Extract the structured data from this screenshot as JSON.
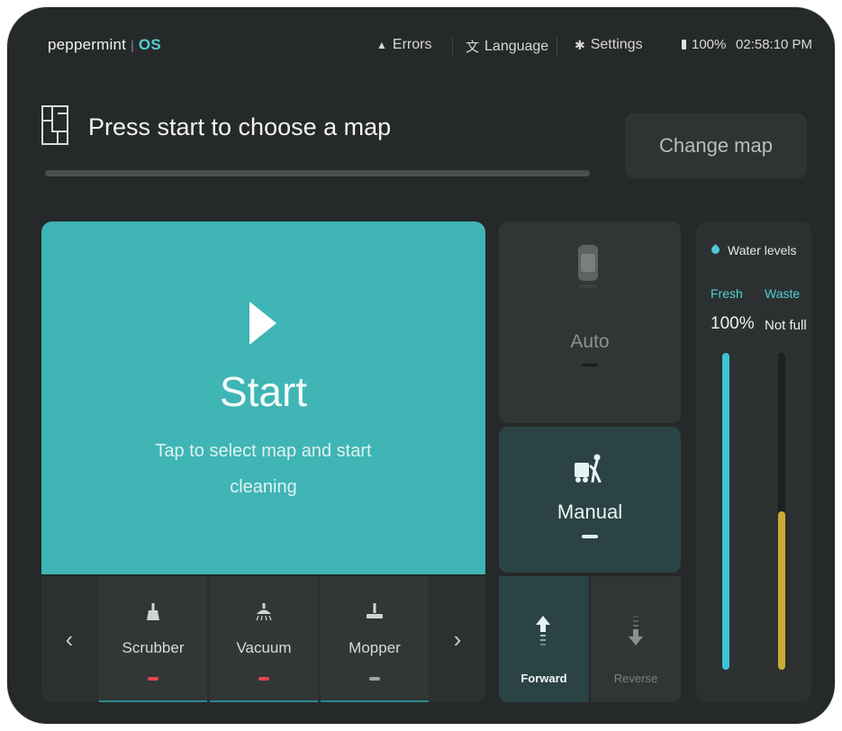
{
  "topbar": {
    "brand": "peppermint",
    "brand_sep": "|",
    "brand_os": "OS",
    "errors": "Errors",
    "language": "Language",
    "settings": "Settings",
    "battery": "100%",
    "time": "02:58:10 PM"
  },
  "header": {
    "title": "Press start to choose a map",
    "change_map": "Change map"
  },
  "start": {
    "label": "Start",
    "subtitle": "Tap to select map and start cleaning"
  },
  "tools": {
    "prev": "‹",
    "next": "›",
    "items": [
      {
        "label": "Scrubber",
        "icon": "brush-icon",
        "status_color": "#e0474c"
      },
      {
        "label": "Vacuum",
        "icon": "vacuum-icon",
        "status_color": "#e0474c"
      },
      {
        "label": "Mopper",
        "icon": "mop-icon",
        "status_color": "#9ea3a4"
      }
    ]
  },
  "modes": {
    "auto": "Auto",
    "manual": "Manual",
    "forward": "Forward",
    "reverse": "Reverse"
  },
  "water": {
    "title": "Water levels",
    "fresh_label": "Fresh",
    "waste_label": "Waste",
    "fresh_value": "100%",
    "waste_value": "Not full",
    "fresh_level": 1.0,
    "waste_level": 0.5,
    "fresh_color": "#3ec3d3",
    "waste_color": "#c8ad34"
  },
  "colors": {
    "accent": "#3fb5b5",
    "background": "#26292a"
  }
}
